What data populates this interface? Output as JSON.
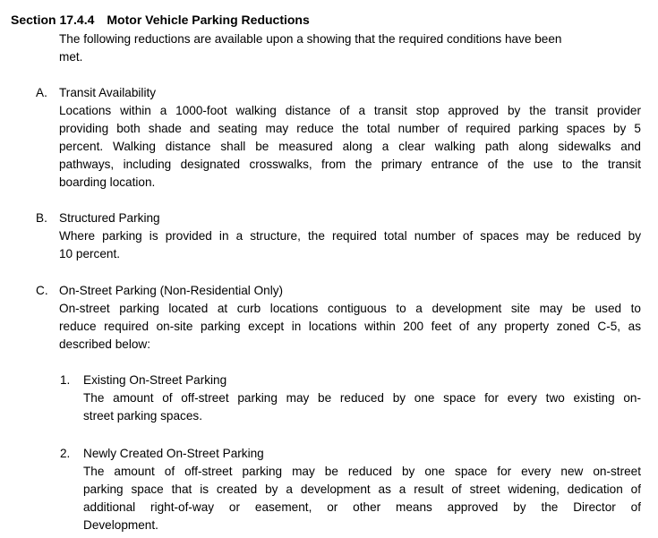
{
  "section": {
    "number": "Section 17.4.4",
    "title": "Motor Vehicle Parking Reductions"
  },
  "intro": [
    "The following reductions are available upon a showing that the required conditions have been",
    "met."
  ],
  "items": [
    {
      "marker": "A.",
      "title": "Transit Availability",
      "lines": [
        "Locations within a 1000-foot walking distance of a transit stop approved by the transit provider",
        "providing both shade and seating may reduce the total number of required parking spaces by 5",
        "percent. Walking distance shall be measured along a clear walking path along sidewalks and",
        "pathways, including designated crosswalks, from the primary entrance of the use to the transit",
        "boarding location."
      ]
    },
    {
      "marker": "B.",
      "title": "Structured Parking",
      "lines": [
        "Where parking is provided in a structure, the required total number of spaces may be reduced by",
        "10 percent."
      ]
    },
    {
      "marker": "C.",
      "title": "On-Street Parking (Non-Residential Only)",
      "lines": [
        "On-street parking located at curb locations contiguous to a development site may be used to",
        "reduce required on-site parking except in locations within 200 feet of any property zoned C-5, as",
        "described below:"
      ]
    }
  ],
  "subitems": [
    {
      "marker": "1.",
      "title": "Existing On-Street Parking",
      "lines": [
        "The amount of off-street parking may be reduced by one space for every two existing on-",
        "street parking spaces."
      ]
    },
    {
      "marker": "2.",
      "title": "Newly Created On-Street Parking",
      "lines": [
        "The amount of off-street parking may be reduced by one space for every new on-street",
        "parking space that is created by a development as a result of street widening, dedication of",
        "additional right-of-way or easement, or other means approved by the Director of",
        "Development."
      ]
    }
  ]
}
